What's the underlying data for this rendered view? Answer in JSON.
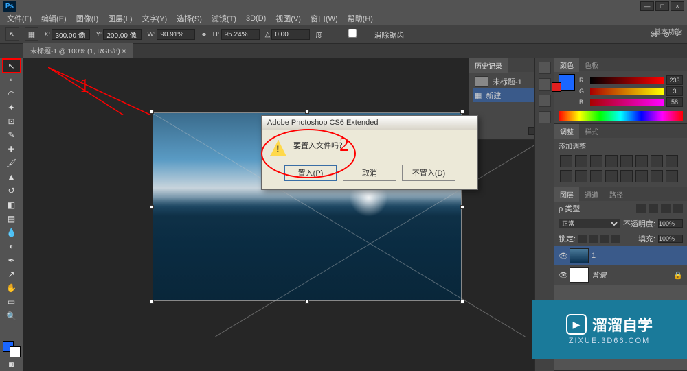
{
  "app_logo": "Ps",
  "menus": [
    "文件(F)",
    "编辑(E)",
    "图像(I)",
    "图层(L)",
    "文字(Y)",
    "选择(S)",
    "滤镜(T)",
    "3D(D)",
    "视图(V)",
    "窗口(W)",
    "帮助(H)"
  ],
  "win_controls": [
    "—",
    "□",
    "×"
  ],
  "options": {
    "x_label": "X:",
    "x_value": "300.00 像",
    "y_label": "Y:",
    "y_value": "200.00 像",
    "w_label": "W:",
    "w_value": "90.91%",
    "h_label": "H:",
    "h_value": "95.24%",
    "angle_label": "△",
    "angle_value": "0.00",
    "unit": "度",
    "antialias": "消除锯齿"
  },
  "workspace": "基本功能",
  "doc_tab": "未标题-1 @ 100% (1, RGB/8) ×",
  "tools": [
    "↖",
    "▫",
    "⊞",
    "✂",
    "✎",
    "✓",
    "✍",
    "⌫",
    "▭",
    "◐",
    "⊕",
    "T",
    "↗",
    "✋",
    "🔍"
  ],
  "history": {
    "tab": "历史记录",
    "doc": "未标题-1",
    "item": "新建"
  },
  "color": {
    "tab1": "颜色",
    "tab2": "色板",
    "r": "R",
    "r_val": "233",
    "g": "G",
    "g_val": "3",
    "b": "B",
    "b_val": "58"
  },
  "adjust": {
    "tab1": "调整",
    "tab2": "样式",
    "label": "添加调整"
  },
  "layers": {
    "tab1": "图层",
    "tab2": "通道",
    "tab3": "路径",
    "kind": "ρ 类型",
    "blend": "正常",
    "opacity_lbl": "不透明度:",
    "opacity": "100%",
    "lock_lbl": "锁定:",
    "fill_lbl": "填充:",
    "fill": "100%",
    "layer1": "1",
    "bg": "背景"
  },
  "dialog": {
    "title": "Adobe Photoshop CS6 Extended",
    "message": "要置入文件吗？",
    "ok": "置入(P)",
    "cancel": "取消",
    "dont": "不置入(D)"
  },
  "annot": {
    "n1": "1",
    "n2": "2"
  },
  "watermark": {
    "text": "溜溜自学",
    "url": "ZIXUE.3D66.COM"
  }
}
